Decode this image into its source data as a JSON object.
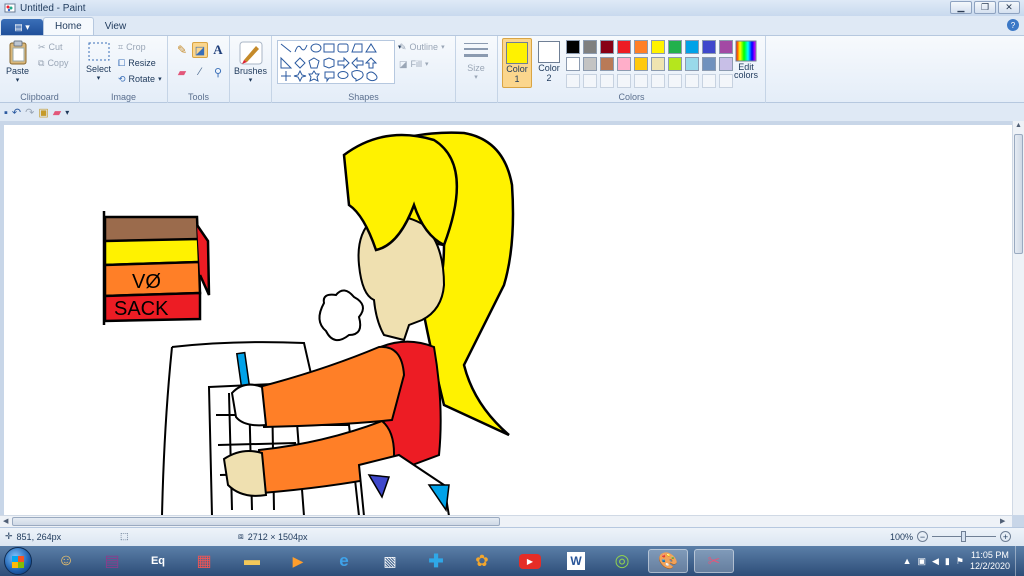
{
  "window": {
    "title": "Untitled - Paint"
  },
  "tabs": [
    {
      "label": "Home"
    },
    {
      "label": "View"
    }
  ],
  "clipboard": {
    "paste": "Paste",
    "cut": "Cut",
    "copy": "Copy",
    "label": "Clipboard"
  },
  "image": {
    "select": "Select",
    "crop": "Crop",
    "resize": "Resize",
    "rotate": "Rotate",
    "label": "Image"
  },
  "tools": {
    "label": "Tools",
    "selected": "fill-icon"
  },
  "brushes": {
    "label": "Brushes"
  },
  "shapes": {
    "label": "Shapes",
    "outline": "Outline",
    "fill": "Fill"
  },
  "size": {
    "label": "Size"
  },
  "colors": {
    "label": "Colors",
    "color1_label": "Color",
    "color1_num": "1",
    "color2_label": "Color",
    "color2_num": "2",
    "color1": "#fff200",
    "color2": "#ffffff",
    "edit_label_1": "Edit",
    "edit_label_2": "colors",
    "palette_row1": [
      "#000000",
      "#7f7f7f",
      "#880015",
      "#ed1c24",
      "#ff7f27",
      "#fff200",
      "#22b14c",
      "#00a2e8",
      "#3f48cc",
      "#a349a4"
    ],
    "palette_row2": [
      "#ffffff",
      "#c3c3c3",
      "#b97a57",
      "#ffaec9",
      "#ffc90e",
      "#efe4b0",
      "#b5e61d",
      "#99d9ea",
      "#7092be",
      "#c8bfe7"
    ]
  },
  "drawing": {
    "label_line1": "VØ",
    "label_line2": "SACK"
  },
  "status": {
    "cursor": "851, 264px",
    "size": "2712 × 1504px",
    "zoom": "100%"
  },
  "clock": {
    "time": "11:05 PM",
    "date": "12/2/2020"
  }
}
